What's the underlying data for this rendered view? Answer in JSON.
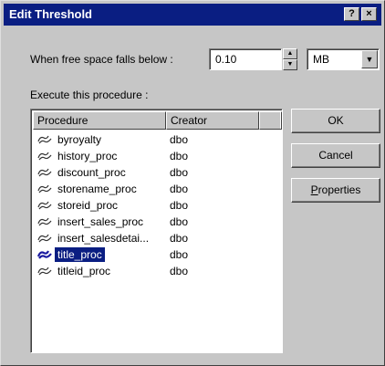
{
  "window": {
    "title": "Edit Threshold",
    "help_label": "?",
    "close_label": "×"
  },
  "threshold": {
    "label": "When free space falls below :",
    "value": "0.10",
    "unit": "MB",
    "spin_up": "▲",
    "spin_down": "▼",
    "dropdown_arrow": "▼"
  },
  "procedure_section": {
    "label": "Execute this procedure :",
    "columns": [
      "Procedure",
      "Creator",
      ""
    ],
    "rows": [
      {
        "name": "byroyalty",
        "creator": "dbo"
      },
      {
        "name": "history_proc",
        "creator": "dbo"
      },
      {
        "name": "discount_proc",
        "creator": "dbo"
      },
      {
        "name": "storename_proc",
        "creator": "dbo"
      },
      {
        "name": "storeid_proc",
        "creator": "dbo"
      },
      {
        "name": "insert_sales_proc",
        "creator": "dbo"
      },
      {
        "name": "insert_salesdetai...",
        "creator": "dbo"
      },
      {
        "name": "title_proc",
        "creator": "dbo",
        "selected": true
      },
      {
        "name": "titleid_proc",
        "creator": "dbo"
      }
    ],
    "icon": "stored-procedure-icon"
  },
  "buttons": {
    "ok": "OK",
    "cancel": "Cancel",
    "properties_first": "P",
    "properties_rest": "roperties"
  },
  "colors": {
    "titlebar": "#0a1e82",
    "face": "#c6c6c6",
    "selection": "#0a1e82"
  }
}
